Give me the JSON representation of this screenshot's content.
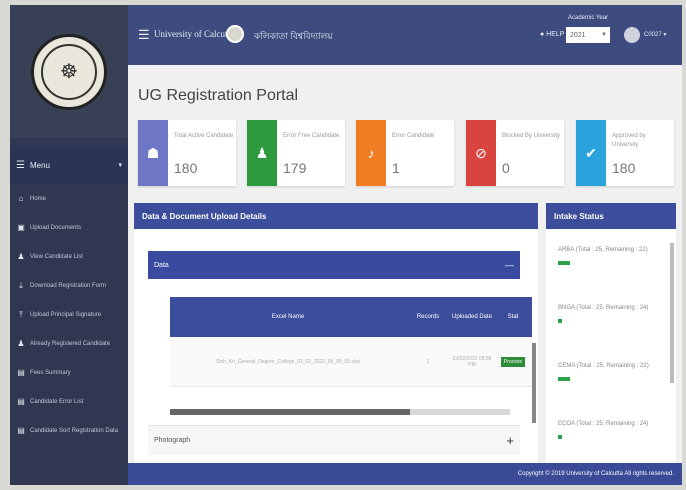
{
  "header": {
    "title": "University of Calcutta",
    "title_bengali": "কলিকাতা বিশ্ববিদ্যালয়",
    "help": "HELP",
    "academic_year_label": "Academic Year",
    "academic_year_value": "2021",
    "user": "C0027"
  },
  "sidebar": {
    "menu_label": "Menu",
    "items": [
      {
        "label": "Home",
        "icon": "home-icon"
      },
      {
        "label": "Upload Documents",
        "icon": "file-upload-icon"
      },
      {
        "label": "View Candidate List",
        "icon": "users-icon"
      },
      {
        "label": "Download Registration Form",
        "icon": "download-icon"
      },
      {
        "label": "Upload Principal Signature",
        "icon": "upload-icon"
      },
      {
        "label": "Already Registered Candidate",
        "icon": "users-icon"
      },
      {
        "label": "Fees Summary",
        "icon": "document-icon"
      },
      {
        "label": "Candidate Error List",
        "icon": "document-icon"
      },
      {
        "label": "Candidate Sort Registration Data",
        "icon": "document-icon"
      }
    ]
  },
  "page": {
    "title": "UG Registration Portal"
  },
  "stats": [
    {
      "label": "Total Active Candidate",
      "value": "180",
      "color": "#6e77c6",
      "icon": "users-icon"
    },
    {
      "label": "Error Free Candidate",
      "value": "179",
      "color": "#2e9a3e",
      "icon": "user-icon"
    },
    {
      "label": "Error Candidate",
      "value": "1",
      "color": "#f07c24",
      "icon": "bell-icon"
    },
    {
      "label": "Blocked By University",
      "value": "0",
      "color": "#d9443f",
      "icon": "block-icon"
    },
    {
      "label": "Approved by University",
      "value": "180",
      "color": "#2aa3dc",
      "icon": "thumbs-up-icon"
    }
  ],
  "data_panel": {
    "title": "Data & Document Upload Details",
    "section_title": "Data",
    "columns": [
      "Excel Name",
      "Records",
      "Uploaded Date",
      "Stat"
    ],
    "rows": [
      {
        "name": "Sinh_Kri_General_Degree_College_02_02_2022_05_09_55.xlsx",
        "records": "1",
        "date": "03/02/2022 05:58 PM",
        "status": "Process"
      }
    ],
    "photograph_label": "Photograph"
  },
  "intake": {
    "title": "Intake Status",
    "items": [
      {
        "text": "ARBA (Total : 25, Remaining : 22)",
        "fill": 0.12
      },
      {
        "text": "BNGA (Total : 25, Remaining : 24)",
        "fill": 0.04
      },
      {
        "text": "CEMA (Total : 25, Remaining : 22)",
        "fill": 0.12
      },
      {
        "text": "ECOA (Total : 25, Remaining : 24)",
        "fill": 0.04
      }
    ]
  },
  "footer": {
    "text": "Copyright © 2019 University of Calcutta All rights reserved."
  }
}
